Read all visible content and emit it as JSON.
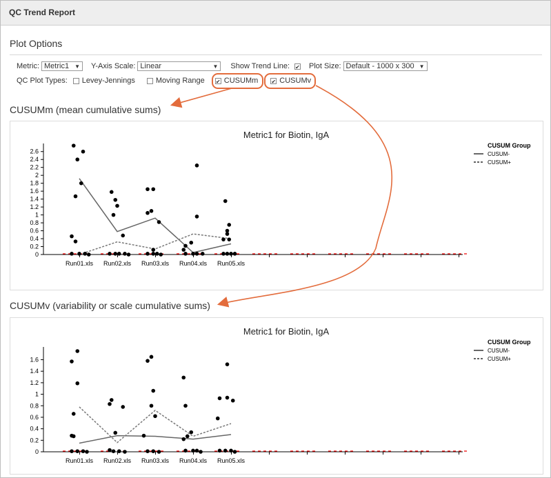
{
  "window": {
    "title": "QC Trend Report"
  },
  "plot_options": {
    "heading": "Plot Options",
    "metric_label": "Metric:",
    "metric_value": "Metric1",
    "y_axis_label": "Y-Axis Scale:",
    "y_axis_value": "Linear",
    "trend_label": "Show Trend Line:",
    "trend_checked": true,
    "size_label": "Plot Size:",
    "size_value": "Default - 1000 x 300",
    "types_label": "QC Plot Types:",
    "types": [
      {
        "label": "Levey-Jennings",
        "checked": false
      },
      {
        "label": "Moving Range",
        "checked": false
      },
      {
        "label": "CUSUMm",
        "checked": true
      },
      {
        "label": "CUSUMv",
        "checked": true
      }
    ]
  },
  "accent_color": "#e36c3c",
  "sections": [
    {
      "heading": "CUSUMm (mean cumulative sums)",
      "plot_title": "Metric1 for Biotin, IgA",
      "legend_title": "CUSUM Group",
      "legend": [
        "CUSUM-",
        "CUSUM+"
      ]
    },
    {
      "heading": "CUSUMv (variability or scale cumulative sums)",
      "plot_title": "Metric1 for Biotin, IgA",
      "legend_title": "CUSUM Group",
      "legend": [
        "CUSUM-",
        "CUSUM+"
      ]
    }
  ],
  "chart_data": [
    {
      "type": "scatter",
      "title": "Metric1 for Biotin, IgA",
      "categories": [
        "Run01.xls",
        "Run02.xls",
        "Run03.xls",
        "Run04.xls",
        "Run05.xls"
      ],
      "ylim": [
        0,
        2.7
      ],
      "yticks": [
        "0",
        "0.2",
        "0.4",
        "0.6",
        "0.8",
        "1",
        "1.2",
        "1.4",
        "1.6",
        "1.8",
        "2",
        "2.2",
        "2.4",
        "2.6"
      ],
      "legend_title": "CUSUM Group",
      "points": [
        [
          0.25,
          2.75
        ],
        [
          0.35,
          2.4
        ],
        [
          0.5,
          2.6
        ],
        [
          0.45,
          1.8
        ],
        [
          0.3,
          1.47
        ],
        [
          0.2,
          0.46
        ],
        [
          0.3,
          0.33
        ],
        [
          0.2,
          0.02
        ],
        [
          0.4,
          0.02
        ],
        [
          0.55,
          0.02
        ],
        [
          0.65,
          0
        ],
        [
          1.25,
          1.58
        ],
        [
          1.35,
          1.38
        ],
        [
          1.4,
          1.23
        ],
        [
          1.3,
          1.0
        ],
        [
          1.55,
          0.48
        ],
        [
          1.2,
          0.02
        ],
        [
          1.35,
          0.02
        ],
        [
          1.45,
          0.02
        ],
        [
          1.6,
          0.02
        ],
        [
          1.7,
          0
        ],
        [
          2.2,
          1.65
        ],
        [
          2.35,
          1.65
        ],
        [
          2.3,
          1.1
        ],
        [
          2.2,
          1.05
        ],
        [
          2.5,
          0.82
        ],
        [
          2.35,
          0.12
        ],
        [
          2.2,
          0.02
        ],
        [
          2.35,
          0.02
        ],
        [
          2.45,
          0.02
        ],
        [
          2.55,
          0
        ],
        [
          3.5,
          2.25
        ],
        [
          3.5,
          0.96
        ],
        [
          3.15,
          0.12
        ],
        [
          3.2,
          0.22
        ],
        [
          3.35,
          0.3
        ],
        [
          3.2,
          0.02
        ],
        [
          3.4,
          0.02
        ],
        [
          3.5,
          0.02
        ],
        [
          3.65,
          0.02
        ],
        [
          4.25,
          1.35
        ],
        [
          4.35,
          0.75
        ],
        [
          4.3,
          0.6
        ],
        [
          4.3,
          0.52
        ],
        [
          4.2,
          0.38
        ],
        [
          4.35,
          0.38
        ],
        [
          4.2,
          0.02
        ],
        [
          4.3,
          0.02
        ],
        [
          4.4,
          0.02
        ],
        [
          4.5,
          0.02
        ]
      ],
      "series": [
        {
          "name": "CUSUM-",
          "style": "solid",
          "values": [
            1.92,
            0.58,
            0.92,
            0.05,
            0.27
          ]
        },
        {
          "name": "CUSUM+",
          "style": "dashed",
          "values": [
            0,
            0.32,
            0.14,
            0.52,
            0.4
          ]
        }
      ]
    },
    {
      "type": "scatter",
      "title": "Metric1 for Biotin, IgA",
      "categories": [
        "Run01.xls",
        "Run02.xls",
        "Run03.xls",
        "Run04.xls",
        "Run05.xls"
      ],
      "ylim": [
        0,
        1.75
      ],
      "yticks": [
        "0",
        "0.2",
        "0.4",
        "0.6",
        "0.8",
        "1",
        "1.2",
        "1.4",
        "1.6"
      ],
      "legend_title": "CUSUM Group",
      "points": [
        [
          0.2,
          1.57
        ],
        [
          0.35,
          1.75
        ],
        [
          0.35,
          1.19
        ],
        [
          0.25,
          0.66
        ],
        [
          0.2,
          0.28
        ],
        [
          0.25,
          0.27
        ],
        [
          0.2,
          0.01
        ],
        [
          0.35,
          0.01
        ],
        [
          0.5,
          0.01
        ],
        [
          0.6,
          0
        ],
        [
          1.25,
          0.9
        ],
        [
          1.2,
          0.83
        ],
        [
          1.55,
          0.78
        ],
        [
          1.35,
          0.33
        ],
        [
          1.2,
          0.03
        ],
        [
          1.3,
          0.01
        ],
        [
          1.45,
          0.01
        ],
        [
          1.6,
          0
        ],
        [
          2.3,
          1.65
        ],
        [
          2.2,
          1.58
        ],
        [
          2.35,
          1.06
        ],
        [
          2.3,
          0.8
        ],
        [
          2.4,
          0.62
        ],
        [
          2.1,
          0.28
        ],
        [
          2.2,
          0.01
        ],
        [
          2.35,
          0.01
        ],
        [
          2.5,
          0
        ],
        [
          3.15,
          1.29
        ],
        [
          3.2,
          0.8
        ],
        [
          3.35,
          0.34
        ],
        [
          3.25,
          0.27
        ],
        [
          3.15,
          0.22
        ],
        [
          3.2,
          0.02
        ],
        [
          3.4,
          0.02
        ],
        [
          3.5,
          0.02
        ],
        [
          3.6,
          0
        ],
        [
          4.3,
          1.52
        ],
        [
          4.1,
          0.93
        ],
        [
          4.3,
          0.94
        ],
        [
          4.45,
          0.89
        ],
        [
          4.05,
          0.58
        ],
        [
          4.1,
          0.02
        ],
        [
          4.25,
          0.02
        ],
        [
          4.4,
          0.02
        ],
        [
          4.5,
          0
        ]
      ],
      "series": [
        {
          "name": "CUSUM-",
          "style": "solid",
          "values": [
            0.15,
            0.28,
            0.27,
            0.22,
            0.3
          ]
        },
        {
          "name": "CUSUM+",
          "style": "dashed",
          "values": [
            0.78,
            0.16,
            0.72,
            0.27,
            0.49
          ]
        }
      ]
    }
  ]
}
